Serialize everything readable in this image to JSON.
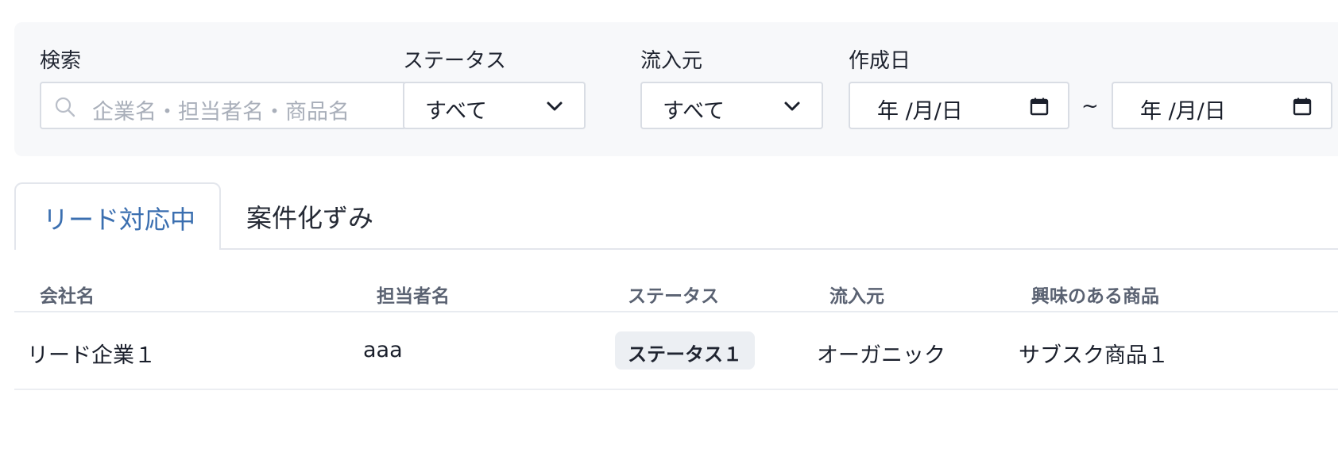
{
  "filters": {
    "search": {
      "label": "検索",
      "placeholder": "企業名・担当者名・商品名"
    },
    "status": {
      "label": "ステータス",
      "value": "すべて"
    },
    "source": {
      "label": "流入元",
      "value": "すべて"
    },
    "created": {
      "label": "作成日",
      "from": "年 /月/日",
      "separator": "~",
      "to": "年 /月/日"
    }
  },
  "tabs": [
    {
      "label": "リード対応中",
      "active": true
    },
    {
      "label": "案件化ずみ",
      "active": false
    }
  ],
  "table": {
    "headers": [
      "会社名",
      "担当者名",
      "ステータス",
      "流入元",
      "興味のある商品"
    ],
    "rows": [
      {
        "company": "リード企業１",
        "contact": "aaa",
        "status": "ステータス１",
        "source": "オーガニック",
        "product": "サブスク商品１"
      }
    ]
  },
  "colors": {
    "accent": "#3b6fb0",
    "panel_bg": "#f7f8fa",
    "badge_bg": "#eceff3"
  },
  "icons": {
    "search": "search-icon",
    "select": "chevron-down-icon",
    "date": "calendar-icon"
  }
}
